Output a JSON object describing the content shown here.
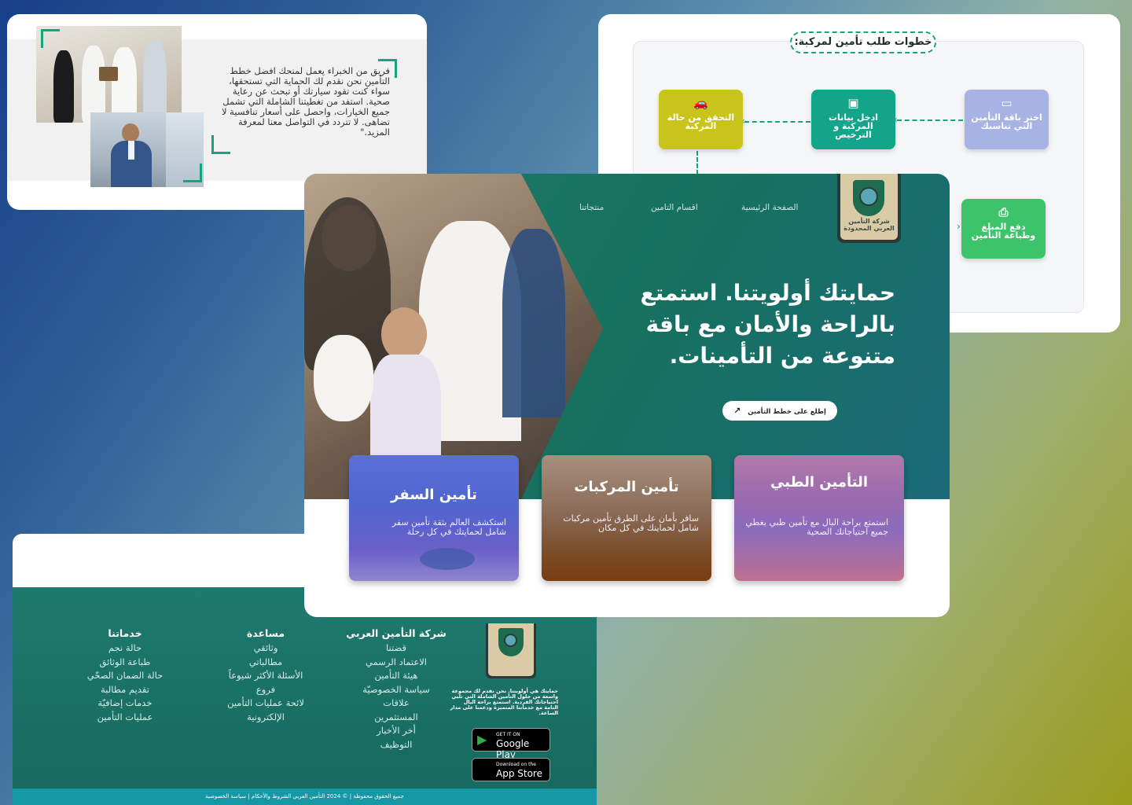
{
  "about": {
    "paragraph": "فريق من الخبراء يعمل لمنحك افضل خطط التأمين نحن نقدم لك الحماية التي تستحقها، سواء كنت تقود سيارتك أو تبحث عن رعاية صحية. استفد من تغطيتنا الشاملة التي تشمل جميع الخيارات، واحصل على أسعار تنافسية لا تضاهى. لا تتردد في التواصل معنا لمعرفة المزيد.\""
  },
  "steps": {
    "title": "خطوات طلب تأمين لمركبة:",
    "items": [
      {
        "label": "اختر باقة التأمين التي تناسبك",
        "icon": "document-icon",
        "color": "#a7b3e5"
      },
      {
        "label": "ادخل بيانات المركبة و الترخيص",
        "icon": "id-card-icon",
        "color": "#12a58a"
      },
      {
        "label": "التحقق من حالة المركبة",
        "icon": "car-icon",
        "color": "#c8c41a"
      },
      {
        "label": "دفع المبلغ وطباعة التأمين",
        "icon": "printer-icon",
        "color": "#3dc46a"
      }
    ]
  },
  "hero": {
    "nav": [
      "الصفحة الرئيسية",
      "اقسام التامين",
      "منتجاتنا"
    ],
    "logo_text": "شركة التأمين العربي المحدودة",
    "title": "حمايتك أولويتنا. استمتع بالراحة والأمان مع باقة متنوعة من التأمينات.",
    "cta_label": "إطلع على خطط التأمين",
    "services": [
      {
        "title": "تأمين السفر",
        "desc": "استكشف العالم بثقة تأمين سفر شامل لحمايتك في كل رحلة"
      },
      {
        "title": "تأمين المركبات",
        "desc": "سافر بأمان على الطرق تأمين مركبات شامل لحمايتك في كل مكان"
      },
      {
        "title": "التأمين الطبي",
        "desc": "استمتع براحة البال مع تأمين طبي يغطي جميع احتياجاتك الصحية"
      }
    ]
  },
  "footer": {
    "company": {
      "head": "شركة التأمين العربي",
      "items": [
        "قضتنا",
        "الاعتماد الرسمي",
        "هيئة التأمين",
        "سياسة الخصوصيّة",
        "علاقات",
        "المستثمرين",
        "أخر الأخبار",
        "التوظيف"
      ]
    },
    "help": {
      "head": "مساعدة",
      "items": [
        "وثائقي",
        "مطالباتي",
        "الأسئلة الأكثر شيوعاً",
        "فروع",
        "لائحة عمليات التأمين",
        "الإلكترونية"
      ]
    },
    "services": {
      "head": "خدماتنا",
      "items": [
        "حالة نجم",
        "طباعة الوثائق",
        "حالة الضمان الصحّي",
        "تقديم مطالبة",
        "خدمات إضافيّة",
        "عمليات التأمين"
      ]
    },
    "description": "حمايتك هي أولويتنا. نحن نقدم لك مجموعة واسعة من حلول التأمين الشاملة التي تلبي احتياجاتك الفردية. استمتع براحة البال التامة مع خدماتنا المتميزة ودعمنا على مدار الساعة.",
    "google_play": {
      "small": "GET IT ON",
      "big": "Google Play"
    },
    "app_store": {
      "small": "Download on the",
      "big": "App Store"
    },
    "copyright": "جميع الحقوق محفوظة | © 2024 التأمين العربي  الشروط والأحكام | سياسة الخصوصية"
  }
}
